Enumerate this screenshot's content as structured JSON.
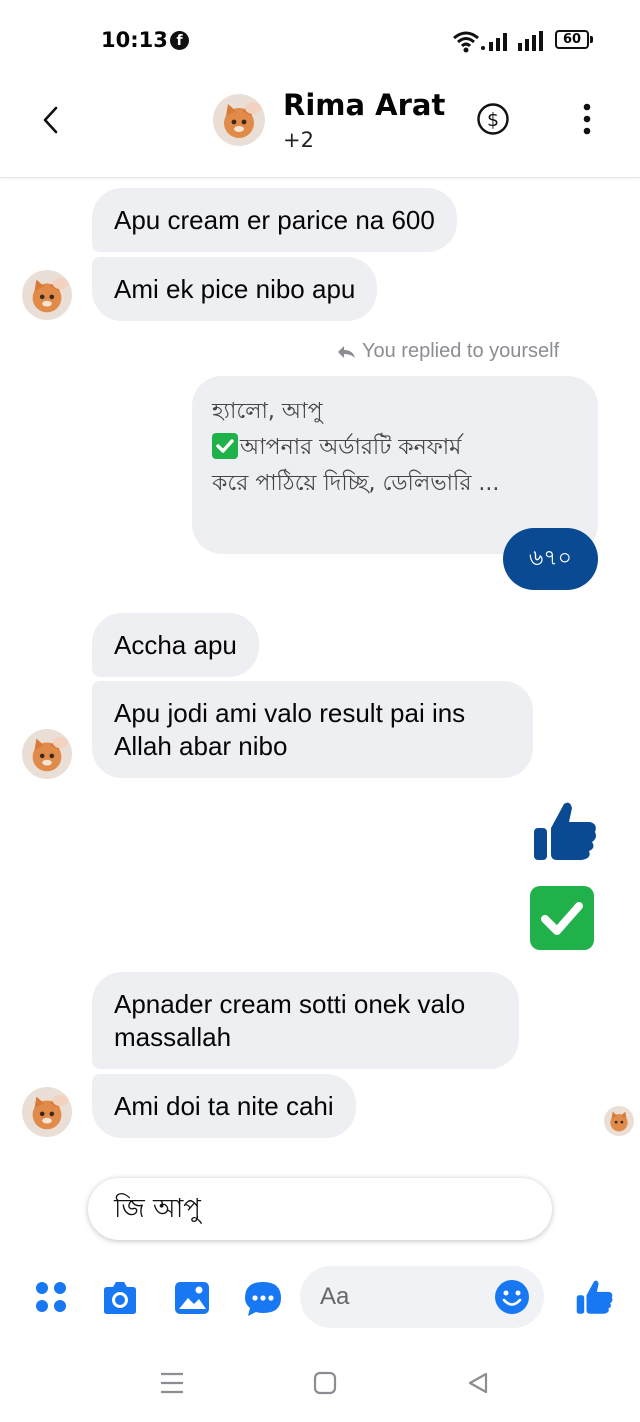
{
  "status_bar": {
    "time": "10:13",
    "battery": "60"
  },
  "header": {
    "name": "Rima Arat",
    "subtitle": "+2"
  },
  "messages": {
    "m1": "Apu cream er parice na 600",
    "m2": "Ami ek pice nibo apu",
    "replied_note": "You replied to yourself",
    "reply_line1": "হ্যালো, আপু",
    "reply_line2": "আপনার অর্ডারটি কনফার্ম",
    "reply_line3": "করে পাঠিয়ে দিচ্ছি, ডেলিভারি ...",
    "price": "৬৭০",
    "m3": "Accha apu",
    "m4_line1": "Apu jodi ami valo result pai ins",
    "m4_line2": "Allah abar nibo",
    "m5_line1": "Apnader cream sotti onek valo",
    "m5_line2": "massallah",
    "m6": "Ami  doi ta nite cahi"
  },
  "quick_reply": "জি আপু",
  "composer": {
    "placeholder": "Aa"
  },
  "icons": {
    "back": "chevron-left-icon",
    "payment": "dollar-icon",
    "more": "more-vertical-icon",
    "apps": "four-dots-icon",
    "camera": "camera-icon",
    "gallery": "image-icon",
    "chat_bubble": "messenger-bubble-icon",
    "emoji": "smiley-icon",
    "like": "thumbs-up-icon"
  },
  "colors": {
    "accent": "#1877f2",
    "bubble_in": "#eeeff2",
    "price_bubble": "#0a4a93",
    "check_green": "#21b14b",
    "muted": "#8a8d91"
  }
}
